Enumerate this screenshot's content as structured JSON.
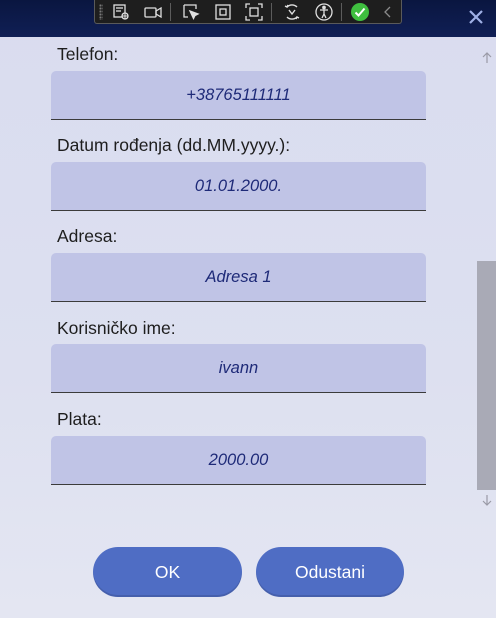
{
  "toolbar": {
    "icons": [
      "select-element-icon",
      "record-video-icon",
      "select-arrow-icon",
      "display-layout-adorner-icon",
      "track-focus-icon",
      "hot-reload-icon",
      "accessibility-icon",
      "checkmark-status-icon",
      "collapse-chevron-icon"
    ]
  },
  "window": {
    "close_icon": "close-icon"
  },
  "form": {
    "fields": [
      {
        "label": "Telefon:",
        "value": "+38765111111"
      },
      {
        "label": "Datum rođenja (dd.MM.yyyy.):",
        "value": "01.01.2000."
      },
      {
        "label": "Adresa:",
        "value": "Adresa 1"
      },
      {
        "label": "Korisničko ime:",
        "value": "ivann"
      },
      {
        "label": "Plata:",
        "value": "2000.00"
      }
    ]
  },
  "buttons": {
    "ok_label": "OK",
    "cancel_label": "Odustani"
  },
  "colors": {
    "title_bar": "#0a1640",
    "field_background": "#c0c4e6",
    "field_text": "#1e2a78",
    "button": "#4f6dc4",
    "status_ok": "#3fbf3f"
  }
}
